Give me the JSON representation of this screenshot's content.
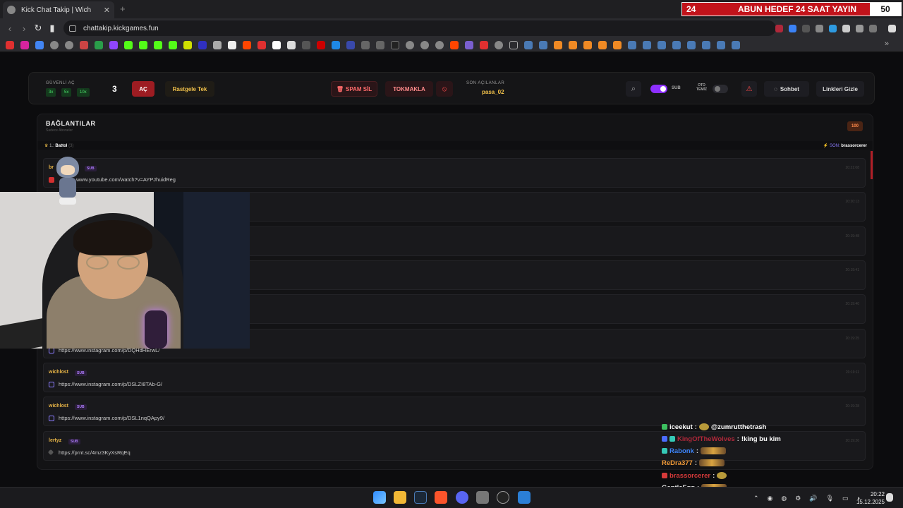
{
  "browser": {
    "tab_title": "Kick Chat Takip | Wich",
    "new_tab": "+",
    "close_tab": "✕",
    "url": "chattakip.kickgames.fun",
    "more": "»"
  },
  "banner": {
    "left": "24",
    "middle": "ABUN HEDEF 24 SAAT YAYIN",
    "right": "50"
  },
  "toolbar": {
    "guvenli_label": "GÜVENLİ AÇ",
    "multipliers": [
      "3x",
      "5x",
      "10x"
    ],
    "count": "3",
    "ac_label": "AÇ",
    "rastgele_label": "Rastgele Tek",
    "spam_label": "SPAM SİL",
    "tokmakla_label": "TOKMAKLA",
    "son_acilanlar_label": "SON AÇILANLAR",
    "son_acilanlar_value": "pasa_02",
    "sub_label": "SUB",
    "oto_temiz_label_1": "OTO",
    "oto_temiz_label_2": "TEMİZ",
    "sohbet_label": "Sohbet",
    "linkleri_gizle_label": "Linkleri Gizle"
  },
  "panel": {
    "title": "BAĞLANTILAR",
    "subtitle": "Sadece Aboneler",
    "count": "100",
    "stat_left_prefix": "1.:",
    "stat_left_user": "Battol",
    "stat_left_count": "(3)",
    "stat_right_prefix": "SON:",
    "stat_right_user": "brassorcerer"
  },
  "rows": [
    {
      "user": "br",
      "badge": "SUB",
      "link": "www.youtube.com/watch?v=AYPJhuidReg",
      "time": "20:21:08",
      "icon_color": "#d32f2f"
    },
    {
      "user": "",
      "badge": "",
      "link": "",
      "time": "20:20:13",
      "icon_color": "#555"
    },
    {
      "user": "",
      "badge": "",
      "link": "",
      "time": "20:19:48",
      "icon_color": "#555"
    },
    {
      "user": "",
      "badge": "",
      "link": "",
      "time": "20:19:41",
      "icon_color": "#555"
    },
    {
      "user": "",
      "badge": "",
      "link": "",
      "time": "20:19:40",
      "icon_color": "#555"
    },
    {
      "user": "",
      "badge": "",
      "link": "https://www.instagram.com/p/DQHdHErwL/",
      "time": "20:19:25",
      "icon_color": "#8c7dff"
    },
    {
      "user": "wichlost",
      "badge": "SUB",
      "link": "https://www.instagram.com/p/DSLZI8TAb-G/",
      "time": "20:19:11",
      "icon_color": "#8c7dff"
    },
    {
      "user": "wichlost",
      "badge": "SUB",
      "link": "https://www.instagram.com/p/DSL1nqQApy9/",
      "time": "20:19:28",
      "icon_color": "#8c7dff"
    },
    {
      "user": "lertyz",
      "badge": "SUB",
      "link": "https://prnt.sc/4mz3KyXsRqEq",
      "time": "20:19:26",
      "icon_color": "#555"
    }
  ],
  "chat_overlay": [
    {
      "user": "iceekut",
      "user_color": "#ffffff",
      "sep": ":",
      "text": "@zumrutthetrash",
      "badge_color": "#3cc060",
      "emote": "small"
    },
    {
      "user": "KingOfTheWolves",
      "user_color": "#b0283a",
      "sep": ":",
      "text": "!king bu kim",
      "badge_color": "#4b6cff",
      "emote": ""
    },
    {
      "user": "Rabonk",
      "user_color": "#3b82f6",
      "sep": ":",
      "text": "",
      "badge_color": "#35c9b6",
      "emote": "wide"
    },
    {
      "user": "ReDra377",
      "user_color": "#f09a38",
      "sep": ":",
      "text": "",
      "badge_color": "",
      "emote": "wide"
    },
    {
      "user": "brassorcerer",
      "user_color": "#d63a3a",
      "sep": ":",
      "text": "",
      "badge_color": "#d63a3a",
      "emote": "small"
    },
    {
      "user": "GentleFgg",
      "user_color": "#e8e8e8",
      "sep": ":",
      "text": "",
      "badge_color": "",
      "emote": "wide"
    }
  ],
  "taskbar": {
    "time": "20:22",
    "date": "15.12.2025"
  },
  "colors": {
    "accent_red": "#9d1c22",
    "accent_gold": "#f0c04a",
    "accent_purple": "#8d2fff",
    "kick_green": "#53fc18"
  }
}
